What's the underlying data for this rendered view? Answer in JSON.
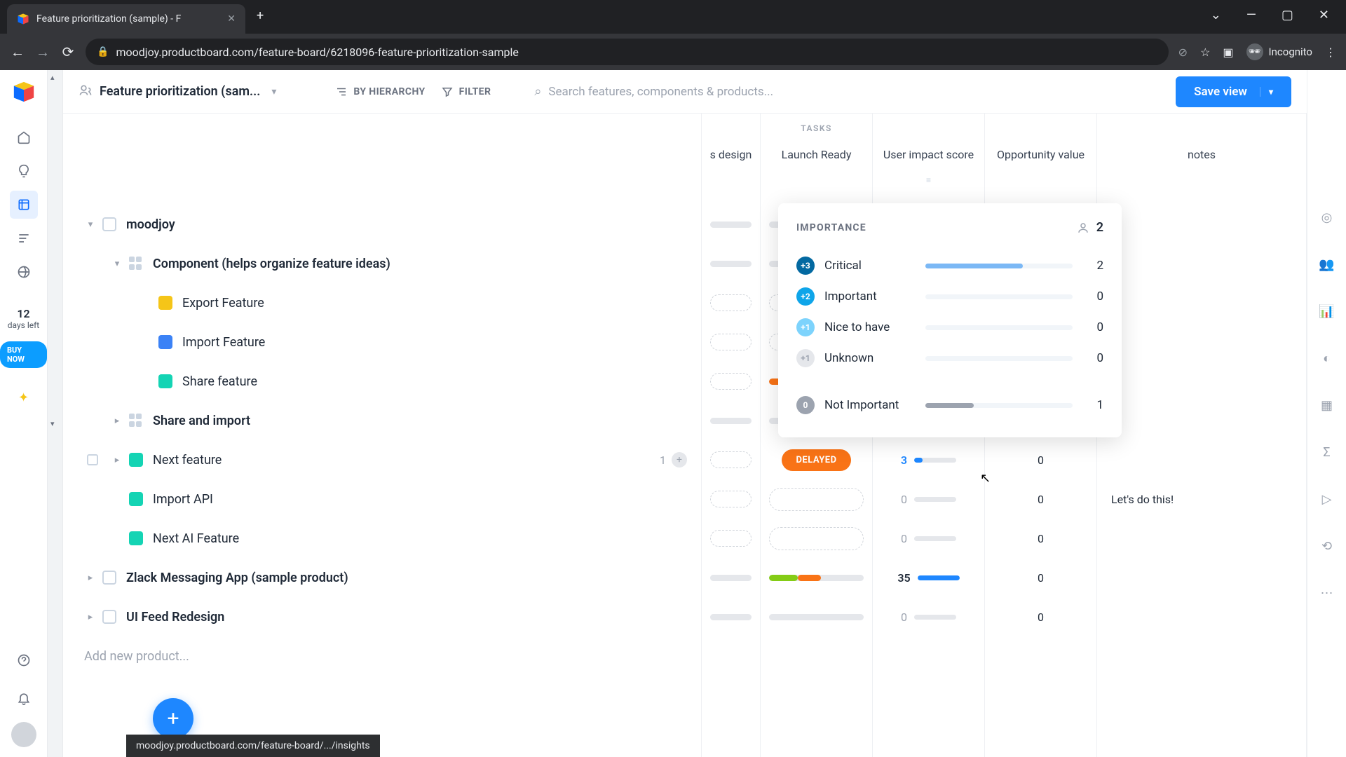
{
  "browser": {
    "tab_title": "Feature prioritization (sample) - F",
    "url": "moodjoy.productboard.com/feature-board/6218096-feature-prioritization-sample",
    "incognito_label": "Incognito"
  },
  "header": {
    "view_name": "Feature prioritization (sam...",
    "by_hierarchy": "BY HIERARCHY",
    "filter": "FILTER",
    "search_placeholder": "Search features, components & products...",
    "save_view": "Save view"
  },
  "trial": {
    "days": "12",
    "days_label": "days left",
    "buy": "BUY NOW"
  },
  "columns": {
    "group_tasks": "TASKS",
    "design": "s design",
    "launch": "Launch Ready",
    "impact": "User impact score",
    "opp": "Opportunity value",
    "notes": "notes"
  },
  "tree": [
    {
      "label": "moodjoy",
      "kind": "product",
      "expand": "down",
      "bold": true
    },
    {
      "label": "Component (helps organize feature ideas)",
      "kind": "component",
      "indent": 1,
      "expand": "down",
      "bold": true
    },
    {
      "label": "Export Feature",
      "kind": "feature",
      "color": "yellow",
      "indent": 2
    },
    {
      "label": "Import Feature",
      "kind": "feature",
      "color": "blue",
      "indent": 2
    },
    {
      "label": "Share feature",
      "kind": "feature",
      "color": "teal",
      "indent": 2
    },
    {
      "label": "Share and import",
      "kind": "component",
      "indent": 1,
      "expand": "right",
      "bold": true
    },
    {
      "label": "Next feature",
      "kind": "feature",
      "color": "teal",
      "indent": 1,
      "expand": "right",
      "hovered": true,
      "meta_count": "1"
    },
    {
      "label": "Import API",
      "kind": "feature",
      "color": "teal",
      "indent": 1
    },
    {
      "label": "Next AI Feature",
      "kind": "feature",
      "color": "teal",
      "indent": 1
    },
    {
      "label": "Zlack Messaging App (sample product)",
      "kind": "product",
      "expand": "right",
      "bold": true
    },
    {
      "label": "UI Feed Redesign",
      "kind": "product",
      "expand": "right",
      "bold": true
    },
    {
      "label": "Add new product...",
      "kind": "add",
      "muted": true
    }
  ],
  "cells": {
    "launch": [
      "prog-grey",
      "prog-grey",
      "dashed",
      "dashed",
      "pill-orange",
      "prog-grey",
      "DELAYED",
      "pill-dashed",
      "pill-dashed",
      "prog-mix",
      "prog-grey",
      ""
    ],
    "impact": [
      "",
      "",
      "",
      "",
      "",
      "",
      "3",
      "0",
      "0",
      "35",
      "0",
      ""
    ],
    "impact_fill": [
      0,
      0,
      0,
      0,
      0,
      0,
      20,
      0,
      0,
      100,
      0,
      0
    ],
    "opp": [
      "",
      "",
      "",
      "",
      "",
      "",
      "0",
      "0",
      "0",
      "0",
      "0",
      ""
    ],
    "notes": [
      "",
      "",
      "",
      "",
      "",
      "",
      "",
      "Let's do this!",
      "",
      "",
      "",
      ""
    ]
  },
  "popover": {
    "title": "IMPORTANCE",
    "total": "2",
    "rows": [
      {
        "badge": "+3",
        "cls": "b3",
        "label": "Critical",
        "val": "2",
        "pct": 66,
        "color": "#7bb8f5"
      },
      {
        "badge": "+2",
        "cls": "b2",
        "label": "Important",
        "val": "0",
        "pct": 0,
        "color": "#0ea5e9"
      },
      {
        "badge": "+1",
        "cls": "b1",
        "label": "Nice to have",
        "val": "0",
        "pct": 0,
        "color": "#7dd3fc"
      },
      {
        "badge": "+1",
        "cls": "b1u",
        "label": "Unknown",
        "val": "0",
        "pct": 0,
        "color": "#9ca3af"
      }
    ],
    "footer": {
      "badge": "0",
      "cls": "b0",
      "label": "Not Important",
      "val": "1",
      "pct": 33,
      "color": "#9ca3af"
    }
  },
  "status_url": "moodjoy.productboard.com/feature-board/.../insights"
}
